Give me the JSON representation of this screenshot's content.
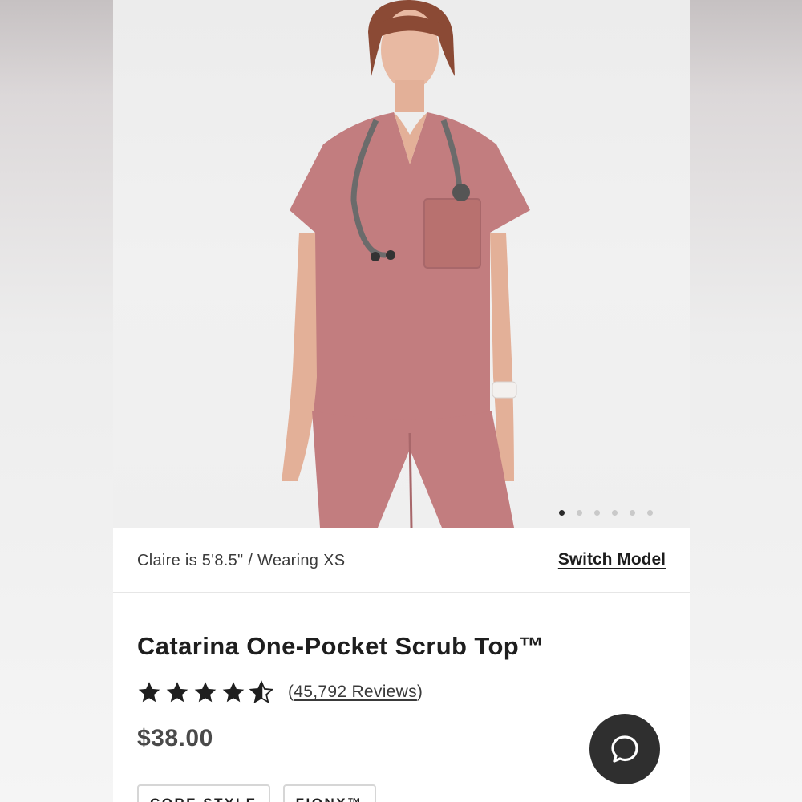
{
  "gallery": {
    "slide_count": 6,
    "active_slide": 1,
    "colors": {
      "scrub": "#c27d7f",
      "scrub_shadow": "#a8676a",
      "background": "#efefef"
    }
  },
  "model_bar": {
    "info_text": "Claire is 5'8.5\" / Wearing XS",
    "switch_label": "Switch Model"
  },
  "product": {
    "title": "Catarina One-Pocket Scrub Top™",
    "rating": 4.5,
    "rating_max": 5,
    "reviews_open": "(",
    "reviews_label": "45,792 Reviews",
    "reviews_close": ")",
    "price": "$38.00"
  },
  "tags": [
    "CORE STYLE",
    "FIONX™"
  ],
  "icons": {
    "chat": "chat-bubble-icon",
    "star": "star-icon"
  }
}
